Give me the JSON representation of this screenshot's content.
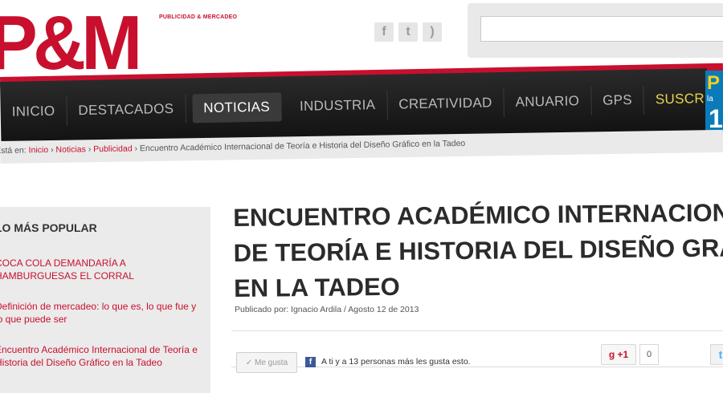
{
  "header": {
    "logo_text": "P&M",
    "tagline": "PUBLICIDAD & MERCADEO",
    "social": [
      {
        "icon": "facebook-icon",
        "glyph": "f"
      },
      {
        "icon": "twitter-icon",
        "glyph": "t"
      },
      {
        "icon": "rss-icon",
        "glyph": ")"
      }
    ],
    "search": {
      "placeholder": "",
      "value": ""
    }
  },
  "nav": {
    "items": [
      "INICIO",
      "DESTACADOS",
      "NOTICIAS",
      "INDUSTRIA",
      "CREATIVIDAD",
      "ANUARIO",
      "GPS",
      "SUSCRÍBASE"
    ],
    "active": "NOTICIAS"
  },
  "breadcrumb": {
    "prefix": "Está en:",
    "links": [
      "Inicio",
      "Noticias",
      "Publicidad"
    ],
    "current": "Encuentro Académico Internacional de Teoría e Historia del Diseño Gráfico en la Tadeo",
    "sep": "›"
  },
  "sidebar": {
    "title": "LO MÁS POPULAR",
    "items": [
      "COCA COLA DEMANDARÍA A HAMBURGUESAS EL CORRAL",
      "Definición de mercadeo: lo que es, lo que fue y lo que puede ser",
      "Encuentro Académico Internacional de Teoría e Historia del Diseño Gráfico en la Tadeo"
    ]
  },
  "article": {
    "title_lines": [
      "ENCUENTRO ACADÉMICO INTERNACIONAL",
      "DE TEORÍA E HISTORIA DEL DISEÑO GRÁFICO",
      "EN LA TADEO"
    ],
    "byline": "Publicado por: Ignacio Ardila / Agosto 12 de 2013"
  },
  "share": {
    "like_label": "Me gusta",
    "fb_text": "A ti y a 13 personas más les gusta esto.",
    "gplus_label": "+1",
    "gplus_count": "0"
  },
  "colors": {
    "brand_red": "#c8102e",
    "nav_bg": "#1a1a1a",
    "subscribe": "#e8d44d"
  }
}
